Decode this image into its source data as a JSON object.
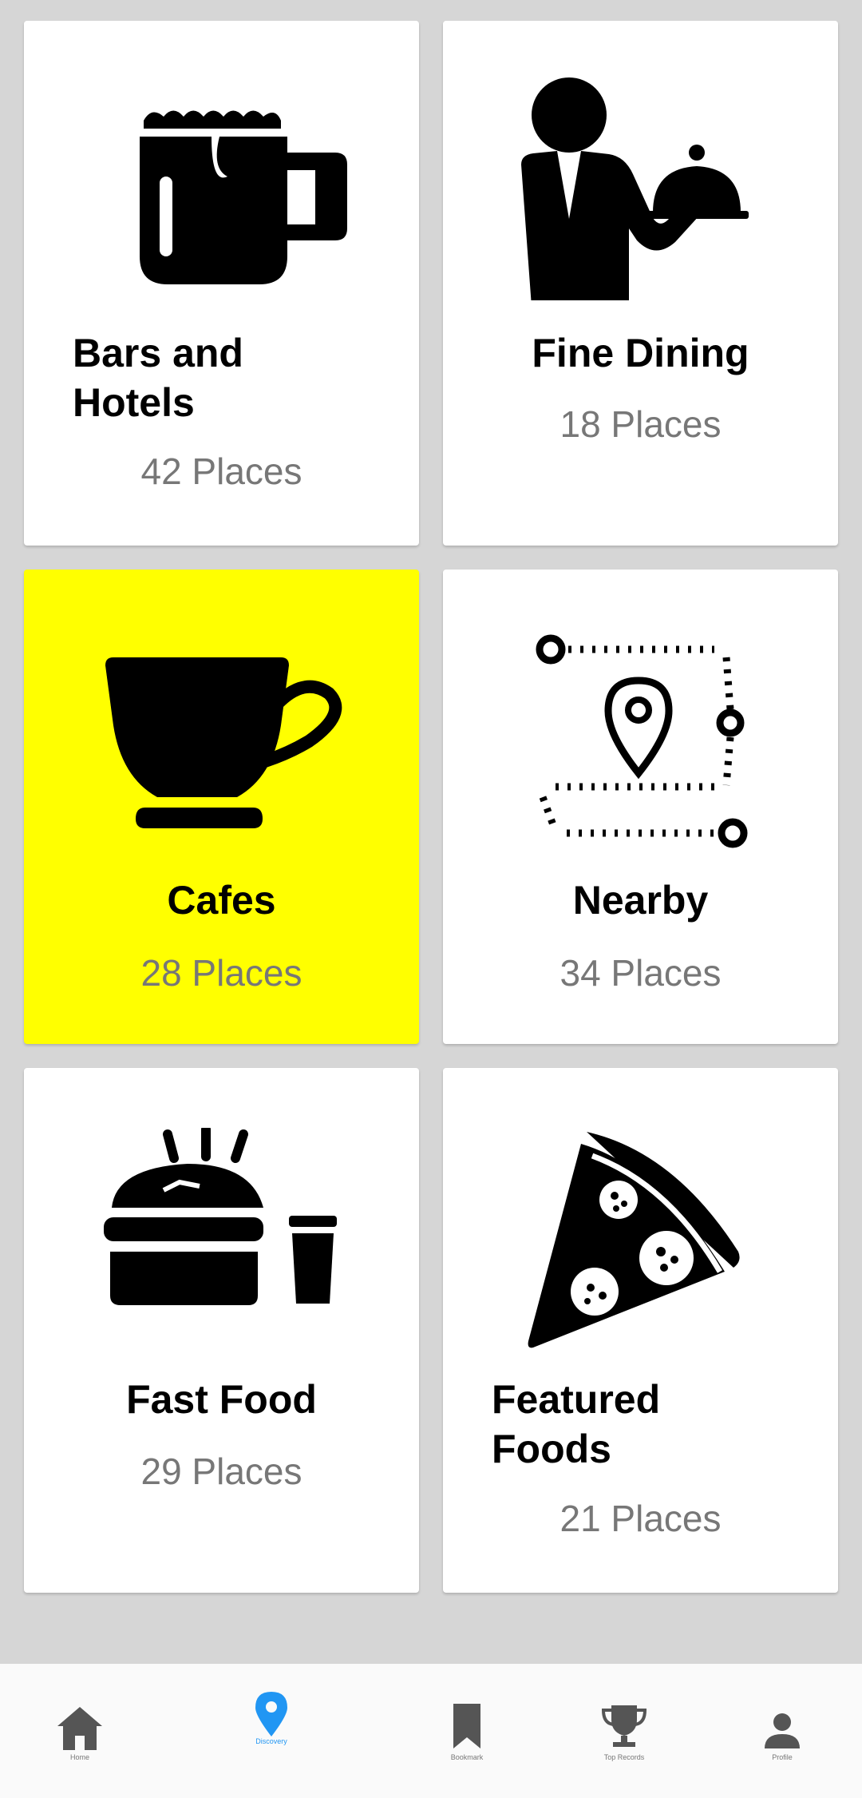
{
  "categories": [
    {
      "title": "Bars and Hotels",
      "count": "42 Places",
      "icon": "beer-mug-icon",
      "active": false
    },
    {
      "title": "Fine Dining",
      "count": "18 Places",
      "icon": "waiter-icon",
      "active": false
    },
    {
      "title": "Cafes",
      "count": "28 Places",
      "icon": "coffee-cup-icon",
      "active": true
    },
    {
      "title": "Nearby",
      "count": "34 Places",
      "icon": "route-pin-icon",
      "active": false
    },
    {
      "title": "Fast Food",
      "count": "29 Places",
      "icon": "burger-drink-icon",
      "active": false
    },
    {
      "title": "Featured Foods",
      "count": "21 Places",
      "icon": "pizza-slice-icon",
      "active": false
    }
  ],
  "bottom_nav": {
    "items": [
      {
        "label": "Home",
        "icon": "home-icon"
      },
      {
        "label": "Discovery",
        "icon": "location-pin-icon",
        "active": true
      },
      {
        "label": "Bookmark",
        "icon": "bookmark-icon"
      },
      {
        "label": "Top Records",
        "icon": "trophy-icon"
      },
      {
        "label": "Profile",
        "icon": "person-icon"
      }
    ]
  },
  "colors": {
    "active_card": "#ffff00",
    "nav_active": "#2196f3",
    "nav_inactive": "#555555",
    "count_text": "#777777"
  }
}
